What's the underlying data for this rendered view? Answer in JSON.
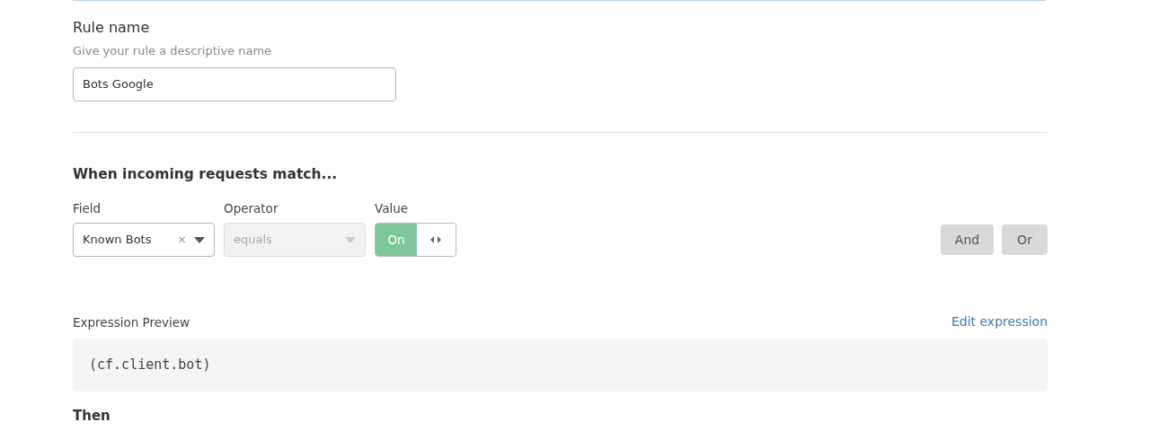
{
  "rule_name": {
    "label": "Rule name",
    "hint": "Give your rule a descriptive name",
    "value": "Bots Google"
  },
  "match": {
    "heading": "When incoming requests match...",
    "field": {
      "label": "Field",
      "value": "Known Bots",
      "clear": "×"
    },
    "operator": {
      "label": "Operator",
      "value": "equals",
      "disabled": true
    },
    "value": {
      "label": "Value",
      "toggle_text": "On",
      "on": true
    },
    "buttons": [
      "And",
      "Or"
    ]
  },
  "preview": {
    "label": "Expression Preview",
    "link": "Edit expression",
    "code": "(cf.client.bot)"
  },
  "then": {
    "heading": "Then"
  }
}
